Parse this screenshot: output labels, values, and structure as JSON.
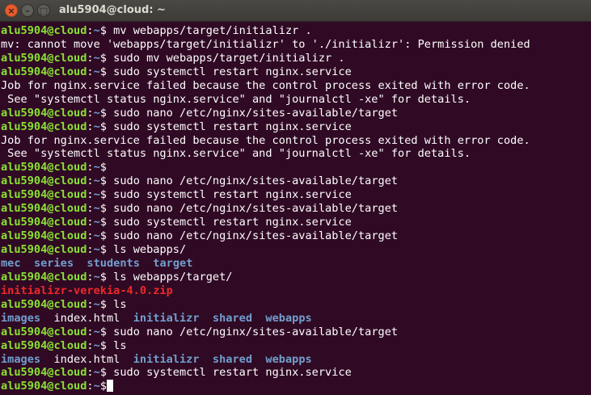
{
  "window": {
    "title": "alu5904@cloud: ~",
    "buttons": {
      "close": "×",
      "minimize": "–",
      "maximize": "□"
    }
  },
  "prompt": {
    "user_host": "alu5904@cloud",
    "colon": ":",
    "path": "~",
    "symbol": "$"
  },
  "lines": [
    {
      "type": "cmd",
      "text": " mv webapps/target/initializr ."
    },
    {
      "type": "out",
      "text": "mv: cannot move 'webapps/target/initializr' to './initializr': Permission denied"
    },
    {
      "type": "cmd",
      "text": " sudo mv webapps/target/initializr ."
    },
    {
      "type": "cmd",
      "text": " sudo systemctl restart nginx.service"
    },
    {
      "type": "out",
      "text": "Job for nginx.service failed because the control process exited with error code."
    },
    {
      "type": "out",
      "text": " See \"systemctl status nginx.service\" and \"journalctl -xe\" for details."
    },
    {
      "type": "cmd",
      "text": " sudo nano /etc/nginx/sites-available/target"
    },
    {
      "type": "cmd",
      "text": " sudo systemctl restart nginx.service"
    },
    {
      "type": "out",
      "text": "Job for nginx.service failed because the control process exited with error code."
    },
    {
      "type": "out",
      "text": " See \"systemctl status nginx.service\" and \"journalctl -xe\" for details."
    },
    {
      "type": "cmd",
      "text": ""
    },
    {
      "type": "cmd",
      "text": " sudo nano /etc/nginx/sites-available/target"
    },
    {
      "type": "cmd",
      "text": " sudo systemctl restart nginx.service"
    },
    {
      "type": "cmd",
      "text": " sudo nano /etc/nginx/sites-available/target"
    },
    {
      "type": "cmd",
      "text": " sudo systemctl restart nginx.service"
    },
    {
      "type": "cmd",
      "text": " sudo nano /etc/nginx/sites-available/target"
    },
    {
      "type": "cmd",
      "text": " ls webapps/"
    },
    {
      "type": "ls",
      "items": [
        {
          "name": "mec",
          "kind": "dir"
        },
        {
          "name": "series",
          "kind": "dir"
        },
        {
          "name": "students",
          "kind": "dir"
        },
        {
          "name": "target",
          "kind": "dir"
        }
      ]
    },
    {
      "type": "cmd",
      "text": " ls webapps/target/"
    },
    {
      "type": "ls",
      "items": [
        {
          "name": "initializr-verekia-4.0.zip",
          "kind": "zip"
        }
      ]
    },
    {
      "type": "cmd",
      "text": " ls"
    },
    {
      "type": "ls",
      "items": [
        {
          "name": "images",
          "kind": "dir"
        },
        {
          "name": "index.html",
          "kind": "file"
        },
        {
          "name": "initializr",
          "kind": "dir"
        },
        {
          "name": "shared",
          "kind": "dir"
        },
        {
          "name": "webapps",
          "kind": "dir"
        }
      ]
    },
    {
      "type": "cmd",
      "text": " sudo nano /etc/nginx/sites-available/target"
    },
    {
      "type": "cmd",
      "text": " ls"
    },
    {
      "type": "ls",
      "items": [
        {
          "name": "images",
          "kind": "dir"
        },
        {
          "name": "index.html",
          "kind": "file"
        },
        {
          "name": "initializr",
          "kind": "dir"
        },
        {
          "name": "shared",
          "kind": "dir"
        },
        {
          "name": "webapps",
          "kind": "dir"
        }
      ]
    },
    {
      "type": "cmd",
      "text": " sudo systemctl restart nginx.service"
    },
    {
      "type": "prompt_active",
      "text": ""
    }
  ],
  "colors": {
    "background": "#300a24",
    "prompt_user": "#8ae234",
    "prompt_path": "#729fcf",
    "directory": "#729fcf",
    "archive": "#ef2929",
    "text": "#ffffff"
  }
}
